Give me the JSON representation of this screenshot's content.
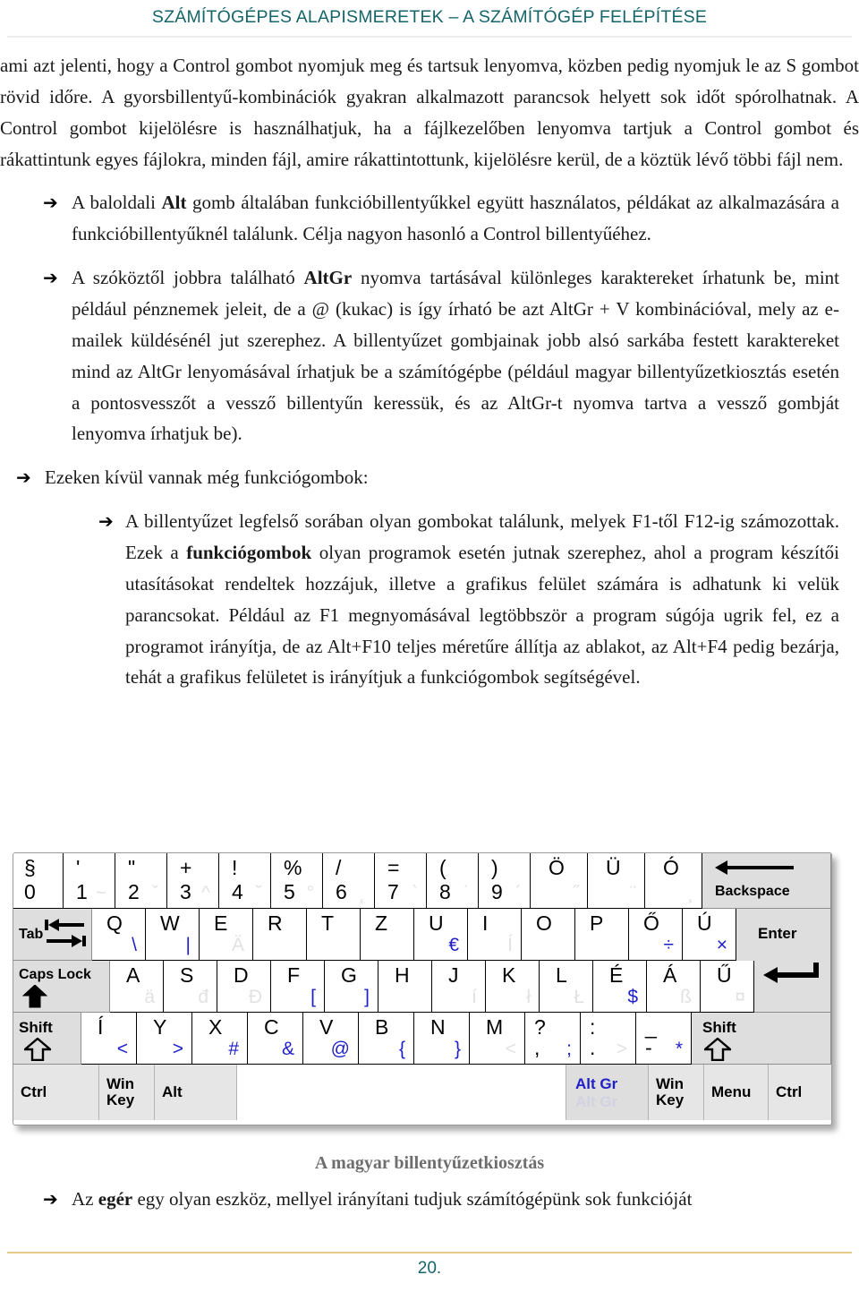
{
  "header": {
    "title": "SZÁMÍTÓGÉPES ALAPISMERETEK – A SZÁMÍTÓGÉP FELÉPÍTÉSE"
  },
  "body": {
    "intro_paragraph": "ami azt jelenti, hogy a Control gombot nyomjuk meg és tartsuk lenyomva, közben pedig nyomjuk le az S gombot rövid időre. A gyorsbillentyű-kombinációk gyakran alkalmazott parancsok helyett sok időt spórolhatnak. A Control gombot kijelölésre is használhatjuk, ha a fájlkezelőben lenyomva tartjuk a Control gombot és rákattintunk egyes fájlokra, minden fájl, amire rákattintottunk, kijelölésre kerül, de a köztük lévő többi fájl nem.",
    "bullet_marker": "➔",
    "bullets": [
      {
        "level": 1,
        "pre": "A baloldali ",
        "bold": "Alt",
        "post": " gomb általában funkcióbillentyűkkel együtt használatos, példákat az alkalmazására a funkcióbillentyűknél találunk. Célja nagyon hasonló a Control billentyűéhez."
      },
      {
        "level": 1,
        "pre": "A szóköztől jobbra található ",
        "bold": "AltGr",
        "post": " nyomva tartásával különleges karaktereket írhatunk be, mint például pénznemek jeleit, de a @ (kukac) is így írható be azt AltGr + V kombinációval, mely az e-mailek küldésénél jut szerephez. A billentyűzet gombjainak jobb alsó sarkába festett karaktereket mind az AltGr lenyomásával írhatjuk be a számítógépbe (például magyar billentyűzetkiosztás esetén a pontosvesszőt a vessző billentyűn keressük, és az AltGr-t nyomva tartva a vessző gombját lenyomva írhatjuk be)."
      }
    ],
    "funkciogombok_intro": "Ezeken kívül vannak még funkciógombok:",
    "funkciogombok_detail": {
      "pre": "A billentyűzet legfelső sorában olyan gombokat találunk, melyek F1-től F12-ig számozottak. Ezek a ",
      "bold": "funkciógombok",
      "post": " olyan programok esetén jutnak szerephez, ahol a program készítői utasításokat rendeltek hozzájuk, illetve a grafikus felület számára is adhatunk ki velük parancsokat. Például az F1 megnyomásával legtöbbször a program súgója ugrik fel, ez a programot irányítja, de az Alt+F10 teljes méretűre állítja az ablakot, az Alt+F4 pedig bezárja, tehát a grafikus felületet is irányítjuk a funkciógombok segítségével."
    },
    "last_bullet": {
      "pre": "Az ",
      "bold": "egér",
      "post": " egy olyan eszköz, mellyel irányítani tudjuk számítógépünk sok funkcióját"
    }
  },
  "figure": {
    "caption": "A magyar billentyűzetkiosztás",
    "keyboard": {
      "row_numbers": [
        {
          "name": "key-0-paragraph",
          "upper": "§",
          "lower": "0",
          "altgr": "",
          "ghost": ""
        },
        {
          "name": "key-1",
          "upper": "'",
          "lower": "1",
          "altgr": "",
          "ghost": "~"
        },
        {
          "name": "key-2",
          "upper": "\"",
          "lower": "2",
          "altgr": "",
          "ghost": "ˇ"
        },
        {
          "name": "key-3",
          "upper": "+",
          "lower": "3",
          "altgr": "",
          "ghost": "^"
        },
        {
          "name": "key-4",
          "upper": "!",
          "lower": "4",
          "altgr": "",
          "ghost": "˘"
        },
        {
          "name": "key-5",
          "upper": "%",
          "lower": "5",
          "altgr": "",
          "ghost": "°"
        },
        {
          "name": "key-6",
          "upper": "/",
          "lower": "6",
          "altgr": "",
          "ghost": "˛"
        },
        {
          "name": "key-7",
          "upper": "=",
          "lower": "7",
          "altgr": "",
          "ghost": "`"
        },
        {
          "name": "key-8",
          "upper": "(",
          "lower": "8",
          "altgr": "",
          "ghost": "˙"
        },
        {
          "name": "key-9",
          "upper": ")",
          "lower": "9",
          "altgr": "",
          "ghost": "´"
        },
        {
          "name": "key-oumlaut",
          "upper": "Ö",
          "lower": "",
          "altgr": "",
          "ghost": "˝"
        },
        {
          "name": "key-uumlaut",
          "upper": "Ü",
          "lower": "",
          "altgr": "",
          "ghost": "¨"
        },
        {
          "name": "key-oacute",
          "upper": "Ó",
          "lower": "",
          "altgr": "",
          "ghost": "¸"
        },
        {
          "name": "key-backspace",
          "label": "Backspace",
          "icon": "arrow-left-icon"
        }
      ],
      "row_qwertz": [
        {
          "name": "key-tab",
          "label": "Tab",
          "icon": "tab-arrows-icon"
        },
        {
          "name": "key-q",
          "upper": "Q",
          "altgr": "\\",
          "ghost": ""
        },
        {
          "name": "key-w",
          "upper": "W",
          "altgr": "|",
          "ghost": ""
        },
        {
          "name": "key-e",
          "upper": "E",
          "altgr": "",
          "ghost": "Ä"
        },
        {
          "name": "key-r",
          "upper": "R",
          "altgr": "",
          "ghost": ""
        },
        {
          "name": "key-t",
          "upper": "T",
          "altgr": "",
          "ghost": ""
        },
        {
          "name": "key-z",
          "upper": "Z",
          "altgr": "",
          "ghost": ""
        },
        {
          "name": "key-u",
          "upper": "U",
          "altgr": "€",
          "ghost": ""
        },
        {
          "name": "key-i",
          "upper": "I",
          "altgr": "",
          "ghost": "Í"
        },
        {
          "name": "key-o",
          "upper": "O",
          "altgr": "",
          "ghost": ""
        },
        {
          "name": "key-p",
          "upper": "P",
          "altgr": "",
          "ghost": ""
        },
        {
          "name": "key-odoubleacute",
          "upper": "Ő",
          "altgr": "÷",
          "ghost": ""
        },
        {
          "name": "key-uacute",
          "upper": "Ú",
          "altgr": "×",
          "ghost": ""
        },
        {
          "name": "key-enter",
          "label": "Enter",
          "icon": "enter-arrow-icon"
        }
      ],
      "row_home": [
        {
          "name": "key-capslock",
          "label": "Caps Lock",
          "icon": "caps-arrow-icon"
        },
        {
          "name": "key-a",
          "upper": "A",
          "altgr": "",
          "ghost": "ä"
        },
        {
          "name": "key-s",
          "upper": "S",
          "altgr": "",
          "ghost": "đ"
        },
        {
          "name": "key-d",
          "upper": "D",
          "altgr": "",
          "ghost": "Đ"
        },
        {
          "name": "key-f",
          "upper": "F",
          "altgr": "[",
          "ghost": ""
        },
        {
          "name": "key-g",
          "upper": "G",
          "altgr": "]",
          "ghost": ""
        },
        {
          "name": "key-h",
          "upper": "H",
          "altgr": "",
          "ghost": ""
        },
        {
          "name": "key-j",
          "upper": "J",
          "altgr": "",
          "ghost": "í"
        },
        {
          "name": "key-k",
          "upper": "K",
          "altgr": "",
          "ghost": "ł"
        },
        {
          "name": "key-l",
          "upper": "L",
          "altgr": "",
          "ghost": "Ł"
        },
        {
          "name": "key-eacute",
          "upper": "É",
          "altgr": "$",
          "ghost": ""
        },
        {
          "name": "key-aacute",
          "upper": "Á",
          "altgr": "",
          "ghost": "ß"
        },
        {
          "name": "key-udoubleacute",
          "upper": "Ű",
          "altgr": "",
          "ghost": "¤"
        }
      ],
      "row_shift": [
        {
          "name": "key-shift-left",
          "label": "Shift",
          "icon": "shift-arrow-icon"
        },
        {
          "name": "key-iacute",
          "upper": "Í",
          "altgr": "<",
          "ghost": ""
        },
        {
          "name": "key-y",
          "upper": "Y",
          "altgr": ">",
          "ghost": ""
        },
        {
          "name": "key-x",
          "upper": "X",
          "altgr": "#",
          "ghost": ""
        },
        {
          "name": "key-c",
          "upper": "C",
          "altgr": "&",
          "ghost": ""
        },
        {
          "name": "key-v",
          "upper": "V",
          "altgr": "@",
          "ghost": ""
        },
        {
          "name": "key-b",
          "upper": "B",
          "altgr": "{",
          "ghost": ""
        },
        {
          "name": "key-n",
          "upper": "N",
          "altgr": "}",
          "ghost": ""
        },
        {
          "name": "key-m",
          "upper": "M",
          "altgr": "",
          "ghost": "<"
        },
        {
          "name": "key-comma",
          "upper": "?",
          "lower": ",",
          "altgr": ";",
          "ghost": ""
        },
        {
          "name": "key-period",
          "upper": ":",
          "lower": ".",
          "altgr": "",
          "ghost": ">"
        },
        {
          "name": "key-dash",
          "upper": "_",
          "lower": "-",
          "altgr": "*",
          "ghost": ""
        },
        {
          "name": "key-shift-right",
          "label": "Shift",
          "icon": "shift-arrow-icon"
        }
      ],
      "row_bottom": [
        {
          "name": "key-ctrl-left",
          "label": "Ctrl"
        },
        {
          "name": "key-win-left",
          "label": "Win Key"
        },
        {
          "name": "key-alt-left",
          "label": "Alt"
        },
        {
          "name": "key-space",
          "label": ""
        },
        {
          "name": "key-altgr",
          "label": "Alt Gr",
          "ghost": "Alt Gr"
        },
        {
          "name": "key-win-right",
          "label": "Win Key"
        },
        {
          "name": "key-menu",
          "label": "Menu"
        },
        {
          "name": "key-ctrl-right",
          "label": "Ctrl"
        }
      ]
    }
  },
  "footer": {
    "page_number": "20."
  },
  "colors": {
    "header_teal": "#15656b",
    "footer_rule": "#e6cb8a",
    "altgr_blue": "#1f1fc8",
    "caption_grey": "#6e6e6e"
  }
}
